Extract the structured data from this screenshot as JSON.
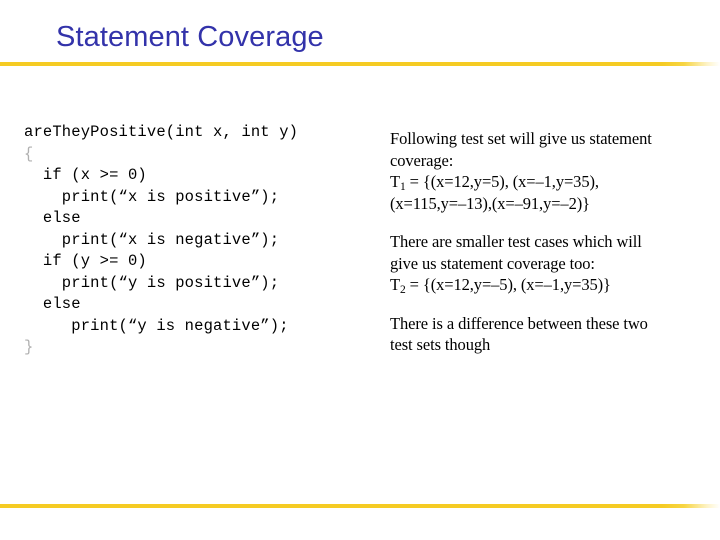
{
  "slide": {
    "title": "Statement Coverage",
    "title_color": "#3333aa",
    "rule_color": "#f5cb23",
    "background_color": "#ffffff"
  },
  "code": {
    "lines": [
      "areTheyPositive(int x, int y)",
      "{",
      "  if (x >= 0)",
      "    print(“x is positive”);",
      "  else",
      "    print(“x is negative”);",
      "  if (y >= 0)",
      "    print(“y is positive”);",
      "  else",
      "     print(“y is negative”);",
      "}"
    ],
    "brace_color": "#b0b0b0"
  },
  "notes": {
    "blocks": [
      {
        "lines": [
          "Following test set will give us statement",
          "coverage:"
        ],
        "formula_label": "T",
        "formula_sub": "1",
        "formula_lines": [
          " = {(x=12,y=5), (x=–1,y=35),",
          "(x=115,y=–13),(x=–91,y=–2)}"
        ]
      },
      {
        "lines": [
          "There are smaller test cases which will",
          "give us statement coverage too:"
        ],
        "formula_label": "T",
        "formula_sub": "2",
        "formula_lines": [
          " = {(x=12,y=–5), (x=–1,y=35)}"
        ]
      },
      {
        "lines": [
          "There is a difference between these two",
          "test sets though"
        ],
        "formula_label": "",
        "formula_sub": "",
        "formula_lines": []
      }
    ]
  }
}
